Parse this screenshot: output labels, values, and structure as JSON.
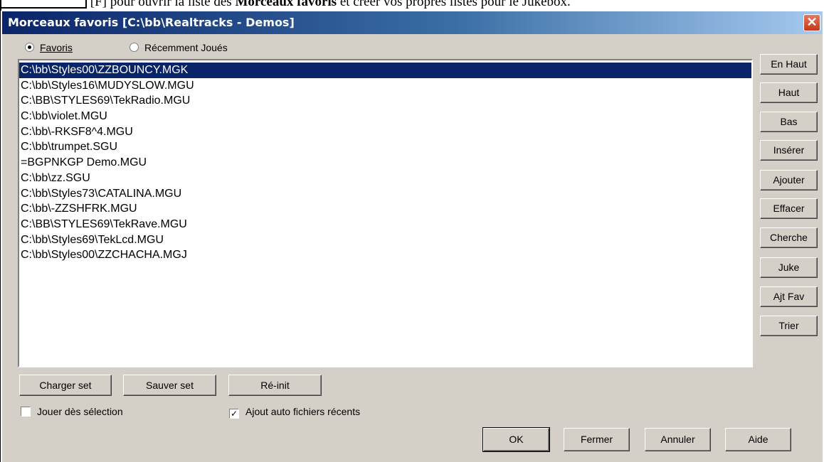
{
  "background_text": {
    "p1": "[F] pour ouvrir la liste des ",
    "p2": "Morceaux favoris",
    "p3": " et créer vos propres listes pour le Jukebox."
  },
  "window": {
    "title": "Morceaux favoris [C:\\bb\\Realtracks - Demos]",
    "close_glyph": "✕"
  },
  "radios": {
    "favoris": "Favoris",
    "recent": "Récemment Joués",
    "selected": "favoris"
  },
  "list": {
    "items": [
      "C:\\bb\\Styles00\\ZZBOUNCY.MGK",
      "C:\\bb\\Styles16\\MUDYSLOW.MGU",
      "C:\\BB\\STYLES69\\TekRadio.MGU",
      "C:\\bb\\violet.MGU",
      "C:\\bb\\-RKSF8^4.MGU",
      "C:\\bb\\trumpet.SGU",
      "=BGPNKGP Demo.MGU",
      "C:\\bb\\zz.SGU",
      "C:\\bb\\Styles73\\CATALINA.MGU",
      "C:\\bb\\-ZZSHFRK.MGU",
      "C:\\BB\\STYLES69\\TekRave.MGU",
      "C:\\bb\\Styles69\\TekLcd.MGU",
      "C:\\bb\\Styles00\\ZZCHACHA.MGJ"
    ],
    "selected_index": 0
  },
  "side_buttons": [
    "En Haut",
    "Haut",
    "Bas",
    "Insérer",
    "Ajouter",
    "Effacer",
    "Cherche",
    "Juke",
    "Ajt Fav",
    "Trier"
  ],
  "set_buttons": {
    "load": "Charger set",
    "save": "Sauver set",
    "reset": "Ré-init"
  },
  "checkboxes": {
    "play_on_select": {
      "label": "Jouer dès sélection",
      "checked": false
    },
    "auto_add_recent": {
      "label": "Ajout auto fichiers récents",
      "checked": true
    }
  },
  "bottom_buttons": {
    "ok": "OK",
    "close": "Fermer",
    "cancel": "Annuler",
    "help": "Aide"
  },
  "colors": {
    "selection": "#0a246a",
    "title_start": "#0a246a",
    "title_end": "#a6caf0",
    "face": "#d4d0c8"
  }
}
